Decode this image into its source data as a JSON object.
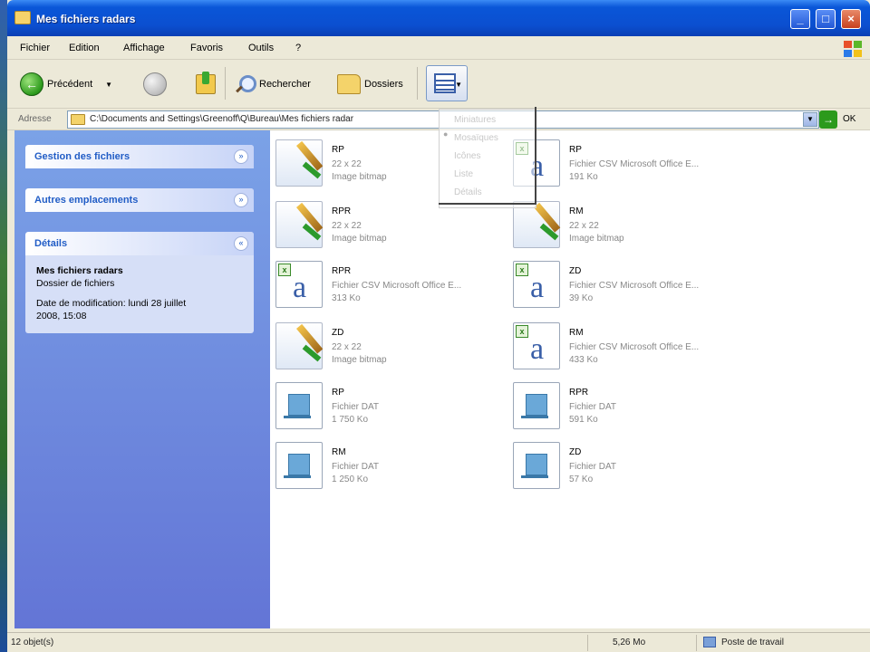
{
  "window": {
    "title": "Mes fichiers radars"
  },
  "menu": [
    "Fichier",
    "Edition",
    "Affichage",
    "Favoris",
    "Outils",
    "?"
  ],
  "toolbar": {
    "back_label": "Précédent",
    "search_label": "Rechercher",
    "folders_label": "Dossiers"
  },
  "address": {
    "label": "Adresse",
    "path": "C:\\Documents and Settings\\Greenoff\\Q\\Bureau\\Mes fichiers radar",
    "go_label": "OK"
  },
  "views_menu": [
    "Miniatures",
    "Mosaïques",
    "Icônes",
    "Liste",
    "Détails"
  ],
  "sidebar": {
    "file_tasks": "Gestion des fichiers",
    "other_places": "Autres emplacements",
    "details": {
      "title": "Détails",
      "name": "Mes fichiers radars",
      "type": "Dossier de fichiers",
      "modified_line1": "Date de modification: lundi 28 juillet",
      "modified_line2": "2008, 15:08"
    }
  },
  "files": [
    {
      "kind": "bmp",
      "name": "RP",
      "line2": "22 x 22",
      "line3": "Image bitmap"
    },
    {
      "kind": "csv",
      "name": "RP",
      "line2": "Fichier CSV Microsoft Office E...",
      "line3": "191 Ko"
    },
    {
      "kind": "bmp",
      "name": "RPR",
      "line2": "22 x 22",
      "line3": "Image bitmap"
    },
    {
      "kind": "bmp",
      "name": "RM",
      "line2": "22 x 22",
      "line3": "Image bitmap"
    },
    {
      "kind": "csv",
      "name": "RPR",
      "line2": "Fichier CSV Microsoft Office E...",
      "line3": "313 Ko"
    },
    {
      "kind": "csv",
      "name": "ZD",
      "line2": "Fichier CSV Microsoft Office E...",
      "line3": "39 Ko"
    },
    {
      "kind": "bmp",
      "name": "ZD",
      "line2": "22 x 22",
      "line3": "Image bitmap"
    },
    {
      "kind": "csv",
      "name": "RM",
      "line2": "Fichier CSV Microsoft Office E...",
      "line3": "433 Ko"
    },
    {
      "kind": "dat",
      "name": "RP",
      "line2": "Fichier DAT",
      "line3": "1 750 Ko"
    },
    {
      "kind": "dat",
      "name": "RPR",
      "line2": "Fichier DAT",
      "line3": "591 Ko"
    },
    {
      "kind": "dat",
      "name": "RM",
      "line2": "Fichier DAT",
      "line3": "1 250 Ko"
    },
    {
      "kind": "dat",
      "name": "ZD",
      "line2": "Fichier DAT",
      "line3": "57 Ko"
    }
  ],
  "status": {
    "objects": "12 objet(s)",
    "size": "5,26 Mo",
    "location": "Poste de travail"
  }
}
